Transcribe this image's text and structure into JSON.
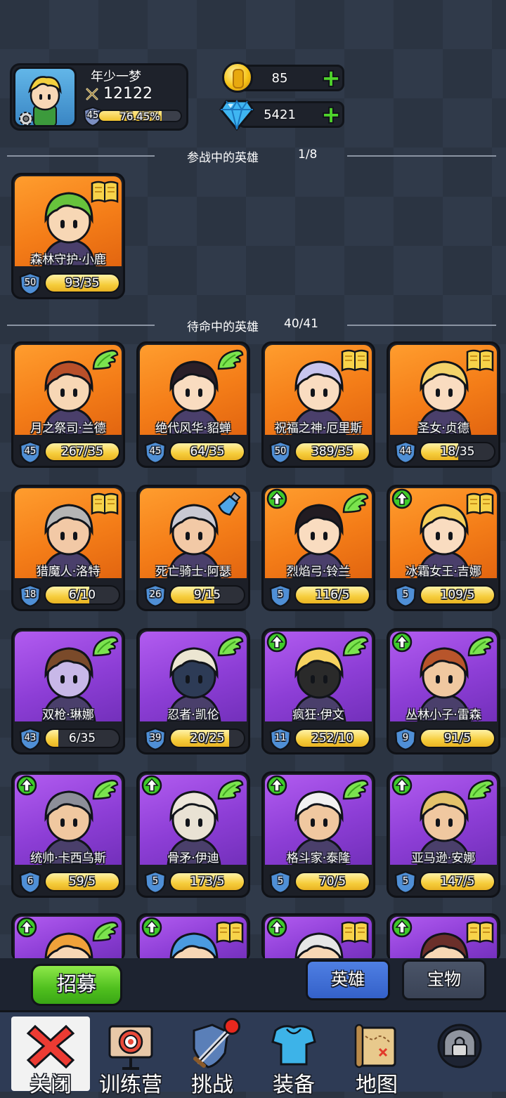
{
  "player": {
    "name": "年少一梦",
    "power": "12122",
    "level": "45",
    "xp_percent_text": "76.45%",
    "xp_fraction": 0.7645
  },
  "currency": {
    "gold": "85",
    "gems": "5421"
  },
  "sections": {
    "active_label": "参战中的英雄",
    "active_count": "1/8",
    "standby_label": "待命中的英雄",
    "standby_count": "40/41"
  },
  "active_heroes": [
    {
      "name": "森林守护·小鹿",
      "level": "50",
      "shards": "93/35",
      "fill": 1.0,
      "bg": "orange",
      "corner": "book-icon",
      "upgrade": false,
      "hair": "#67c33c",
      "skin": "#f7d7b5"
    }
  ],
  "standby_heroes": [
    {
      "name": "月之祭司·兰德",
      "level": "45",
      "shards": "267/35",
      "fill": 1.0,
      "bg": "orange",
      "corner": "wing-icon",
      "upgrade": false,
      "hair": "#b9502a",
      "skin": "#f7d7b5"
    },
    {
      "name": "绝代风华·貂蝉",
      "level": "45",
      "shards": "64/35",
      "fill": 1.0,
      "bg": "orange",
      "corner": "wing-icon",
      "upgrade": false,
      "hair": "#2a1f28",
      "skin": "#f9dcc0"
    },
    {
      "name": "祝福之神·厄里斯",
      "level": "50",
      "shards": "389/35",
      "fill": 1.0,
      "bg": "orange",
      "corner": "book-icon",
      "upgrade": false,
      "hair": "#c8c5ef",
      "skin": "#f9dcc0"
    },
    {
      "name": "圣女·贞德",
      "level": "44",
      "shards": "18/35",
      "fill": 0.514,
      "bg": "orange",
      "corner": "book-icon",
      "upgrade": false,
      "hair": "#f3d36a",
      "skin": "#f9dcc0"
    },
    {
      "name": "猎魔人·洛特",
      "level": "18",
      "shards": "6/10",
      "fill": 0.6,
      "bg": "orange",
      "corner": "book-icon",
      "upgrade": false,
      "hair": "#b5b5b5",
      "skin": "#f2c9a6"
    },
    {
      "name": "死亡骑士·阿瑟",
      "level": "26",
      "shards": "9/15",
      "fill": 0.6,
      "bg": "orange",
      "corner": "potion-icon",
      "upgrade": false,
      "hair": "#c9c9d3",
      "skin": "#f2c9a6"
    },
    {
      "name": "烈焰弓·铃兰",
      "level": "5",
      "shards": "116/5",
      "fill": 1.0,
      "bg": "orange",
      "corner": "wing-icon",
      "upgrade": true,
      "hair": "#221c22",
      "skin": "#f9dcc0"
    },
    {
      "name": "冰霜女王·吉娜",
      "level": "5",
      "shards": "109/5",
      "fill": 1.0,
      "bg": "orange",
      "corner": "book-icon",
      "upgrade": true,
      "hair": "#f5cf5a",
      "skin": "#f9dcc0"
    },
    {
      "name": "双枪·琳娜",
      "level": "43",
      "shards": "6/35",
      "fill": 0.171,
      "bg": "purple",
      "corner": "wing-icon",
      "upgrade": false,
      "hair": "#7a4a2a",
      "skin": "#c8b8e8"
    },
    {
      "name": "忍者·凯伦",
      "level": "39",
      "shards": "20/25",
      "fill": 0.8,
      "bg": "purple",
      "corner": "wing-icon",
      "upgrade": false,
      "hair": "#ece6d2",
      "skin": "#2d3b56"
    },
    {
      "name": "疯狂·伊文",
      "level": "11",
      "shards": "252/10",
      "fill": 1.0,
      "bg": "purple",
      "corner": "wing-icon",
      "upgrade": true,
      "hair": "#f6d360",
      "skin": "#2a2a2a"
    },
    {
      "name": "丛林小子·雷森",
      "level": "9",
      "shards": "91/5",
      "fill": 1.0,
      "bg": "purple",
      "corner": "wing-icon",
      "upgrade": true,
      "hair": "#b8552b",
      "skin": "#f0c8a0"
    },
    {
      "name": "统帅·卡西乌斯",
      "level": "6",
      "shards": "59/5",
      "fill": 1.0,
      "bg": "purple",
      "corner": "wing-icon",
      "upgrade": true,
      "hair": "#8d8f99",
      "skin": "#f0c8a0"
    },
    {
      "name": "骨矛·伊迪",
      "level": "5",
      "shards": "173/5",
      "fill": 1.0,
      "bg": "purple",
      "corner": "wing-icon",
      "upgrade": true,
      "hair": "#ede6da",
      "skin": "#e9e2d4"
    },
    {
      "name": "格斗家·泰隆",
      "level": "5",
      "shards": "70/5",
      "fill": 1.0,
      "bg": "purple",
      "corner": "wing-icon",
      "upgrade": true,
      "hair": "#f2f2f2",
      "skin": "#f0c8a0"
    },
    {
      "name": "亚马逊·安娜",
      "level": "5",
      "shards": "147/5",
      "fill": 1.0,
      "bg": "purple",
      "corner": "wing-icon",
      "upgrade": true,
      "hair": "#e3c26a",
      "skin": "#f0c8a0"
    }
  ],
  "partial_heroes": [
    {
      "bg": "purple",
      "corner": "wing-icon",
      "upgrade": true,
      "hair": "#f0a23a"
    },
    {
      "bg": "purple",
      "corner": "book-icon",
      "upgrade": true,
      "hair": "#4b9be0"
    },
    {
      "bg": "purple",
      "corner": "book-icon",
      "upgrade": true,
      "hair": "#e6e6e6"
    },
    {
      "bg": "purple",
      "corner": "book-icon",
      "upgrade": true,
      "hair": "#6b2f2a"
    }
  ],
  "bottom": {
    "recruit_label": "招募",
    "tab_heroes": "英雄",
    "tab_treasure": "宝物"
  },
  "nav": [
    {
      "label": "关闭",
      "icon": "close-icon"
    },
    {
      "label": "训练营",
      "icon": "target-icon"
    },
    {
      "label": "挑战",
      "icon": "sword-shield-icon"
    },
    {
      "label": "装备",
      "icon": "armor-icon"
    },
    {
      "label": "地图",
      "icon": "map-icon"
    },
    {
      "label": "",
      "icon": "locked-icon"
    }
  ],
  "colors": {
    "gold_bar": "#f6cd3c",
    "upgrade_green": "#3fcb2a",
    "active_tab": "#3f6fd6",
    "red_badge": "#e8281e"
  }
}
